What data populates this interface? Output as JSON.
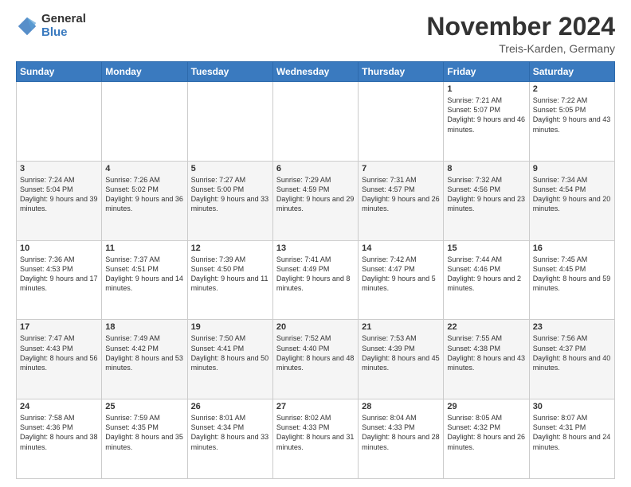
{
  "logo": {
    "general": "General",
    "blue": "Blue"
  },
  "header": {
    "month_title": "November 2024",
    "subtitle": "Treis-Karden, Germany"
  },
  "days_of_week": [
    "Sunday",
    "Monday",
    "Tuesday",
    "Wednesday",
    "Thursday",
    "Friday",
    "Saturday"
  ],
  "weeks": [
    [
      {
        "day": "",
        "info": ""
      },
      {
        "day": "",
        "info": ""
      },
      {
        "day": "",
        "info": ""
      },
      {
        "day": "",
        "info": ""
      },
      {
        "day": "",
        "info": ""
      },
      {
        "day": "1",
        "info": "Sunrise: 7:21 AM\nSunset: 5:07 PM\nDaylight: 9 hours and 46 minutes."
      },
      {
        "day": "2",
        "info": "Sunrise: 7:22 AM\nSunset: 5:05 PM\nDaylight: 9 hours and 43 minutes."
      }
    ],
    [
      {
        "day": "3",
        "info": "Sunrise: 7:24 AM\nSunset: 5:04 PM\nDaylight: 9 hours and 39 minutes."
      },
      {
        "day": "4",
        "info": "Sunrise: 7:26 AM\nSunset: 5:02 PM\nDaylight: 9 hours and 36 minutes."
      },
      {
        "day": "5",
        "info": "Sunrise: 7:27 AM\nSunset: 5:00 PM\nDaylight: 9 hours and 33 minutes."
      },
      {
        "day": "6",
        "info": "Sunrise: 7:29 AM\nSunset: 4:59 PM\nDaylight: 9 hours and 29 minutes."
      },
      {
        "day": "7",
        "info": "Sunrise: 7:31 AM\nSunset: 4:57 PM\nDaylight: 9 hours and 26 minutes."
      },
      {
        "day": "8",
        "info": "Sunrise: 7:32 AM\nSunset: 4:56 PM\nDaylight: 9 hours and 23 minutes."
      },
      {
        "day": "9",
        "info": "Sunrise: 7:34 AM\nSunset: 4:54 PM\nDaylight: 9 hours and 20 minutes."
      }
    ],
    [
      {
        "day": "10",
        "info": "Sunrise: 7:36 AM\nSunset: 4:53 PM\nDaylight: 9 hours and 17 minutes."
      },
      {
        "day": "11",
        "info": "Sunrise: 7:37 AM\nSunset: 4:51 PM\nDaylight: 9 hours and 14 minutes."
      },
      {
        "day": "12",
        "info": "Sunrise: 7:39 AM\nSunset: 4:50 PM\nDaylight: 9 hours and 11 minutes."
      },
      {
        "day": "13",
        "info": "Sunrise: 7:41 AM\nSunset: 4:49 PM\nDaylight: 9 hours and 8 minutes."
      },
      {
        "day": "14",
        "info": "Sunrise: 7:42 AM\nSunset: 4:47 PM\nDaylight: 9 hours and 5 minutes."
      },
      {
        "day": "15",
        "info": "Sunrise: 7:44 AM\nSunset: 4:46 PM\nDaylight: 9 hours and 2 minutes."
      },
      {
        "day": "16",
        "info": "Sunrise: 7:45 AM\nSunset: 4:45 PM\nDaylight: 8 hours and 59 minutes."
      }
    ],
    [
      {
        "day": "17",
        "info": "Sunrise: 7:47 AM\nSunset: 4:43 PM\nDaylight: 8 hours and 56 minutes."
      },
      {
        "day": "18",
        "info": "Sunrise: 7:49 AM\nSunset: 4:42 PM\nDaylight: 8 hours and 53 minutes."
      },
      {
        "day": "19",
        "info": "Sunrise: 7:50 AM\nSunset: 4:41 PM\nDaylight: 8 hours and 50 minutes."
      },
      {
        "day": "20",
        "info": "Sunrise: 7:52 AM\nSunset: 4:40 PM\nDaylight: 8 hours and 48 minutes."
      },
      {
        "day": "21",
        "info": "Sunrise: 7:53 AM\nSunset: 4:39 PM\nDaylight: 8 hours and 45 minutes."
      },
      {
        "day": "22",
        "info": "Sunrise: 7:55 AM\nSunset: 4:38 PM\nDaylight: 8 hours and 43 minutes."
      },
      {
        "day": "23",
        "info": "Sunrise: 7:56 AM\nSunset: 4:37 PM\nDaylight: 8 hours and 40 minutes."
      }
    ],
    [
      {
        "day": "24",
        "info": "Sunrise: 7:58 AM\nSunset: 4:36 PM\nDaylight: 8 hours and 38 minutes."
      },
      {
        "day": "25",
        "info": "Sunrise: 7:59 AM\nSunset: 4:35 PM\nDaylight: 8 hours and 35 minutes."
      },
      {
        "day": "26",
        "info": "Sunrise: 8:01 AM\nSunset: 4:34 PM\nDaylight: 8 hours and 33 minutes."
      },
      {
        "day": "27",
        "info": "Sunrise: 8:02 AM\nSunset: 4:33 PM\nDaylight: 8 hours and 31 minutes."
      },
      {
        "day": "28",
        "info": "Sunrise: 8:04 AM\nSunset: 4:33 PM\nDaylight: 8 hours and 28 minutes."
      },
      {
        "day": "29",
        "info": "Sunrise: 8:05 AM\nSunset: 4:32 PM\nDaylight: 8 hours and 26 minutes."
      },
      {
        "day": "30",
        "info": "Sunrise: 8:07 AM\nSunset: 4:31 PM\nDaylight: 8 hours and 24 minutes."
      }
    ]
  ]
}
